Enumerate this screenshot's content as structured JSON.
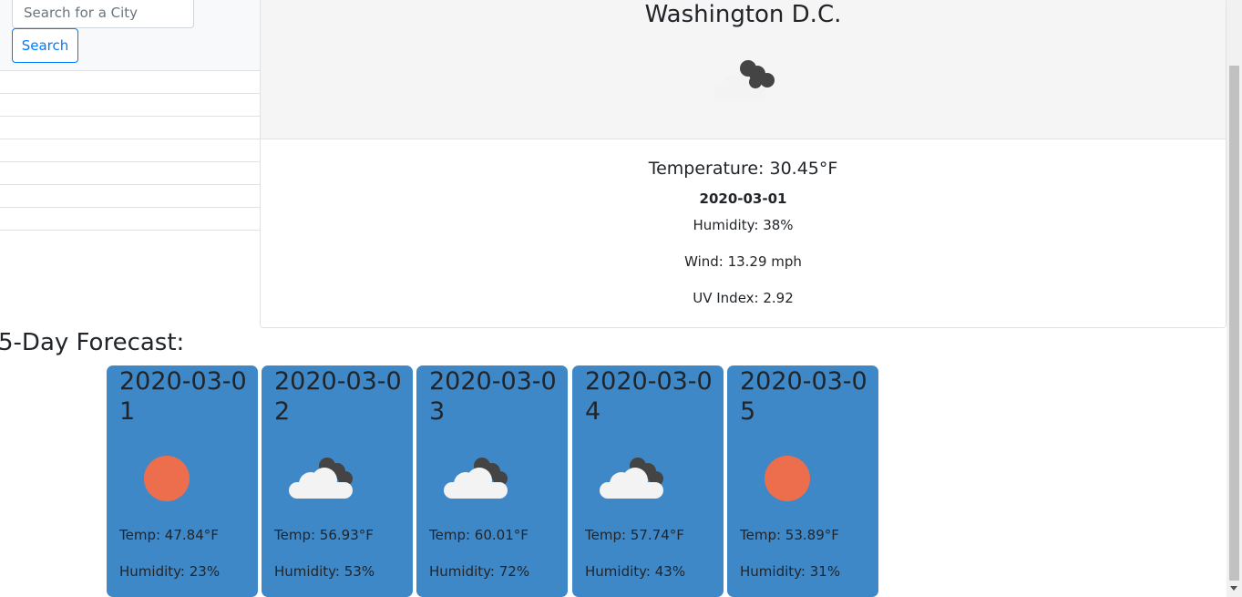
{
  "search": {
    "placeholder": "Search for a City",
    "button_label": "Search"
  },
  "history": {
    "rows": [
      "",
      "",
      "",
      "",
      "",
      "",
      ""
    ]
  },
  "current": {
    "city": "Washington D.C.",
    "icon": "cloudy-icon",
    "temperature": "Temperature: 30.45°F",
    "date": "2020-03-01",
    "humidity": "Humidity: 38%",
    "wind": "Wind: 13.29 mph",
    "uv_index": "UV Index: 2.92"
  },
  "forecast": {
    "title": "5-Day Forecast:",
    "card_color": "#3f88c8",
    "days": [
      {
        "date": "2020-03-01",
        "icon": "sun-icon",
        "temp": "Temp: 47.84°F",
        "humidity": "Humidity: 23%"
      },
      {
        "date": "2020-03-02",
        "icon": "cloudy-icon",
        "temp": "Temp: 56.93°F",
        "humidity": "Humidity: 53%"
      },
      {
        "date": "2020-03-03",
        "icon": "cloudy-icon",
        "temp": "Temp: 60.01°F",
        "humidity": "Humidity: 72%"
      },
      {
        "date": "2020-03-04",
        "icon": "cloudy-icon",
        "temp": "Temp: 57.74°F",
        "humidity": "Humidity: 43%"
      },
      {
        "date": "2020-03-05",
        "icon": "sun-icon",
        "temp": "Temp: 53.89°F",
        "humidity": "Humidity: 31%"
      }
    ]
  },
  "colors": {
    "accent": "#007bff",
    "sun": "#ec6e4c",
    "cloud_light": "#f3f3f3",
    "cloud_dark": "#444444"
  }
}
